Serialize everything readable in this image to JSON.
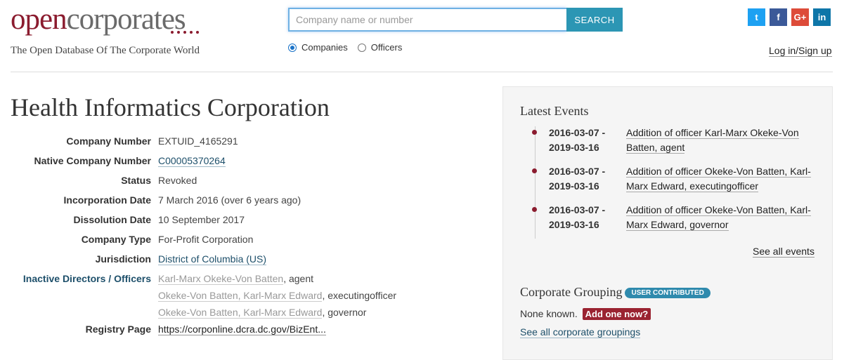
{
  "header": {
    "logo_open": "open",
    "logo_corp": "corporates",
    "tagline": "The Open Database Of The Corporate World",
    "search": {
      "placeholder": "Company name or number",
      "button": "SEARCH"
    },
    "radios": [
      {
        "label": "Companies",
        "selected": true
      },
      {
        "label": "Officers",
        "selected": false
      }
    ],
    "social": [
      {
        "icon": "twitter-icon",
        "glyph": "t",
        "color": "#1da1f2"
      },
      {
        "icon": "facebook-icon",
        "glyph": "f",
        "color": "#3b5998"
      },
      {
        "icon": "googleplus-icon",
        "glyph": "G+",
        "color": "#dd4b39"
      },
      {
        "icon": "linkedin-icon",
        "glyph": "in",
        "color": "#0e76a8"
      }
    ],
    "login": "Log in/Sign up"
  },
  "company": {
    "name": "Health Informatics Corporation",
    "fields": [
      {
        "label": "Company Number",
        "value": "EXTUID_4165291"
      },
      {
        "label": "Native Company Number",
        "value": "C00005370264"
      },
      {
        "label": "Status",
        "value": "Revoked"
      },
      {
        "label": "Incorporation Date",
        "value": "7 March 2016 (over 6 years ago)"
      },
      {
        "label": "Dissolution Date",
        "value": "10 September 2017"
      },
      {
        "label": "Company Type",
        "value": "For-Profit Corporation"
      },
      {
        "label": "Jurisdiction",
        "value": "District of Columbia (US)"
      }
    ],
    "officers_label": "Inactive Directors / Officers",
    "officers": [
      {
        "name": "Karl-Marx Okeke-Von Batten",
        "role": ", agent"
      },
      {
        "name": "Okeke-Von Batten, Karl-Marx Edward",
        "role": ", executingofficer"
      },
      {
        "name": "Okeke-Von Batten, Karl-Marx Edward",
        "role": ", governor"
      }
    ],
    "registry_label": "Registry Page",
    "registry_value": "https://corponline.dcra.dc.gov/BizEnt..."
  },
  "sidebar": {
    "events_title": "Latest Events",
    "events": [
      {
        "date": "2016-03-07 - 2019-03-16",
        "desc": "Addition of officer Karl-Marx Okeke-Von Batten, agent"
      },
      {
        "date": "2016-03-07 - 2019-03-16",
        "desc": "Addition of officer Okeke-Von Batten, Karl-Marx Edward, executingofficer"
      },
      {
        "date": "2016-03-07 - 2019-03-16",
        "desc": "Addition of officer Okeke-Von Batten, Karl-Marx Edward, governor"
      }
    ],
    "see_all_events": "See all events",
    "grouping_title": "Corporate Grouping",
    "grouping_badge": "USER CONTRIBUTED",
    "none_known": "None known.",
    "add_one": "Add one now?",
    "see_groupings": "See all corporate groupings"
  }
}
